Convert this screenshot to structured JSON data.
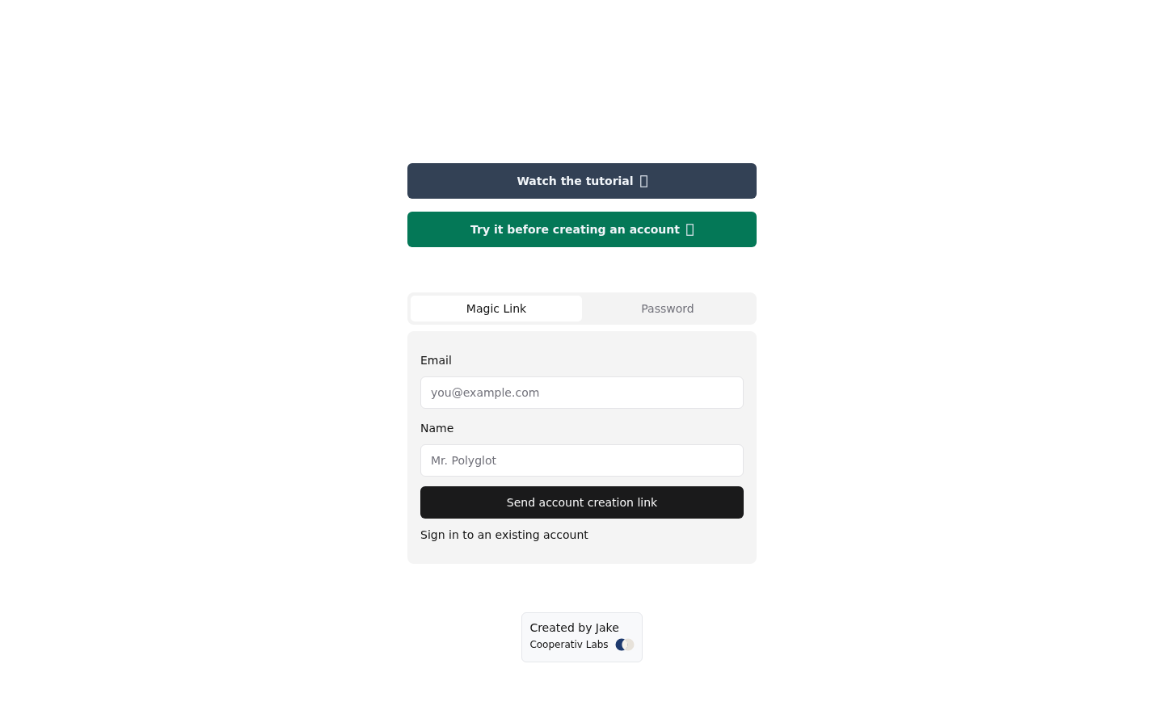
{
  "actions": [
    {
      "kind": "tutorial",
      "label": "Watch the tutorial"
    },
    {
      "kind": "trial",
      "label": "Try it before creating an account"
    }
  ],
  "tabs": [
    {
      "label": "Magic Link",
      "selected": true
    },
    {
      "label": "Password",
      "selected": false
    }
  ],
  "form": {
    "fields": [
      {
        "label": "Email",
        "placeholder": "you@example.com"
      },
      {
        "label": "Name",
        "placeholder": "Mr. Polyglot"
      }
    ],
    "submit": "Send account creation link",
    "link": "Sign in to an existing account"
  },
  "credit": {
    "title": "Created by Jake",
    "company": "Cooperativ Labs"
  }
}
